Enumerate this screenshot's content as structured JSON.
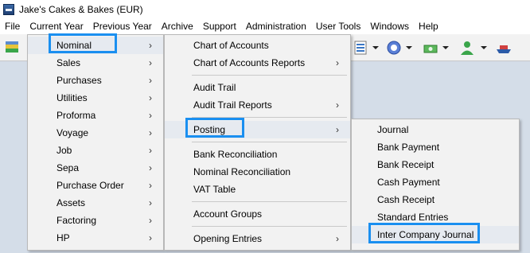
{
  "window": {
    "title": "Jake's Cakes & Bakes (EUR)"
  },
  "menubar": {
    "items": [
      "File",
      "Current Year",
      "Previous Year",
      "Archive",
      "Support",
      "Administration",
      "User Tools",
      "Windows",
      "Help"
    ]
  },
  "menu1": {
    "items": [
      "Nominal",
      "Sales",
      "Purchases",
      "Utilities",
      "Proforma",
      "Voyage",
      "Job",
      "Sepa",
      "Purchase Order",
      "Assets",
      "Factoring",
      "HP"
    ]
  },
  "menu2": {
    "items": [
      "Chart of Accounts",
      "Chart of Accounts Reports",
      "Audit Trail",
      "Audit Trail Reports",
      "Posting",
      "Bank Reconciliation",
      "Nominal Reconciliation",
      "VAT Table",
      "Account Groups",
      "Opening Entries"
    ]
  },
  "menu3": {
    "items": [
      "Journal",
      "Bank Payment",
      "Bank Receipt",
      "Cash Payment",
      "Cash Receipt",
      "Standard Entries",
      "Inter Company Journal"
    ]
  },
  "colors": {
    "highlight": "#1a8ff0",
    "menu_bg": "#f2f2f2",
    "workspace": "#d4dde8"
  }
}
